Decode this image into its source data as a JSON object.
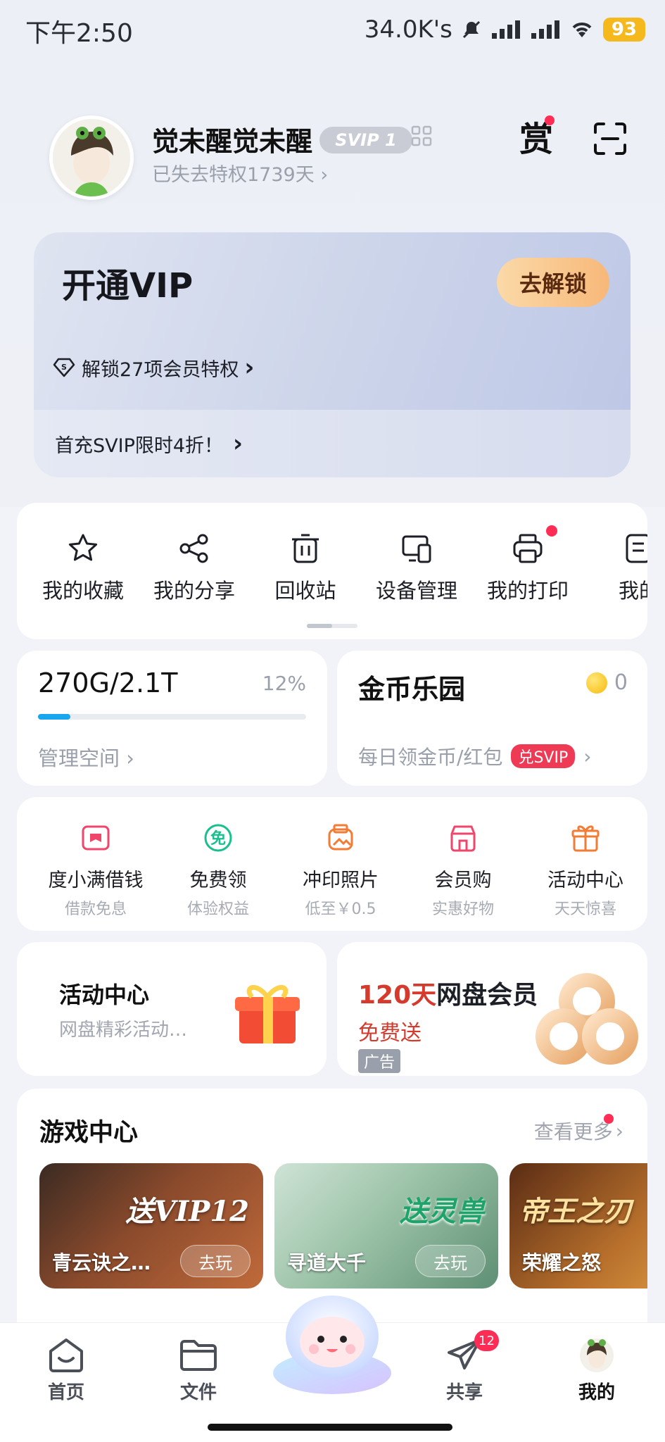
{
  "status_bar": {
    "time": "下午2:50",
    "net_speed": "34.0K's",
    "battery": "93"
  },
  "profile": {
    "username": "觉未醒觉未醒",
    "svip_badge": "SVIP 1",
    "lost_privilege": "已失去特权1739天",
    "reward_icon_text": "赏"
  },
  "vip_card": {
    "title": "开通VIP",
    "unlock_button": "去解锁",
    "unlock_row": "解锁27项会员特权",
    "promo": "首充SVIP限时4折！"
  },
  "tools": [
    {
      "label": "我的收藏",
      "icon": "star-icon"
    },
    {
      "label": "我的分享",
      "icon": "share-icon"
    },
    {
      "label": "回收站",
      "icon": "trash-icon"
    },
    {
      "label": "设备管理",
      "icon": "device-icon"
    },
    {
      "label": "我的打印",
      "icon": "printer-icon"
    },
    {
      "label": "我的",
      "icon": "document-icon"
    }
  ],
  "storage": {
    "amount": "270G/2.1T",
    "percent": "12%",
    "used_fraction": 0.12,
    "manage": "管理空间"
  },
  "coins": {
    "title": "金币乐园",
    "count": "0",
    "subtitle": "每日领金币/红包",
    "tag": "兑SVIP"
  },
  "services": [
    {
      "label": "度小满借钱",
      "sub": "借款免息",
      "icon": "wallet-icon",
      "color": "#f0466b"
    },
    {
      "label": "免费领",
      "sub": "体验权益",
      "icon": "free-icon",
      "color": "#19c08d"
    },
    {
      "label": "冲印照片",
      "sub": "低至￥0.5",
      "icon": "photo-print-icon",
      "color": "#f47b33"
    },
    {
      "label": "会员购",
      "sub": "实惠好物",
      "icon": "shop-icon",
      "color": "#f0466b"
    },
    {
      "label": "活动中心",
      "sub": "天天惊喜",
      "icon": "gift-icon",
      "color": "#f47b33"
    }
  ],
  "activity": {
    "title": "活动中心",
    "subtitle": "网盘精彩活动…"
  },
  "ad": {
    "title_red": "120天",
    "title_dark": "网盘会员",
    "subtitle": "免费送",
    "tag": "广告"
  },
  "games": {
    "title": "游戏中心",
    "more": "查看更多",
    "items": [
      {
        "name": "青云诀之…",
        "play": "去玩",
        "art": "送VIP12"
      },
      {
        "name": "寻道大千",
        "play": "去玩",
        "art": "送灵兽"
      },
      {
        "name": "荣耀之怒",
        "play": "",
        "art": "帝王之刃"
      }
    ]
  },
  "bottom_nav": {
    "items": [
      {
        "label": "首页",
        "icon": "home-icon"
      },
      {
        "label": "文件",
        "icon": "folder-icon"
      },
      {
        "label": "共享",
        "icon": "send-icon",
        "badge": "12"
      },
      {
        "label": "我的",
        "icon": "profile-avatar-icon"
      }
    ]
  }
}
